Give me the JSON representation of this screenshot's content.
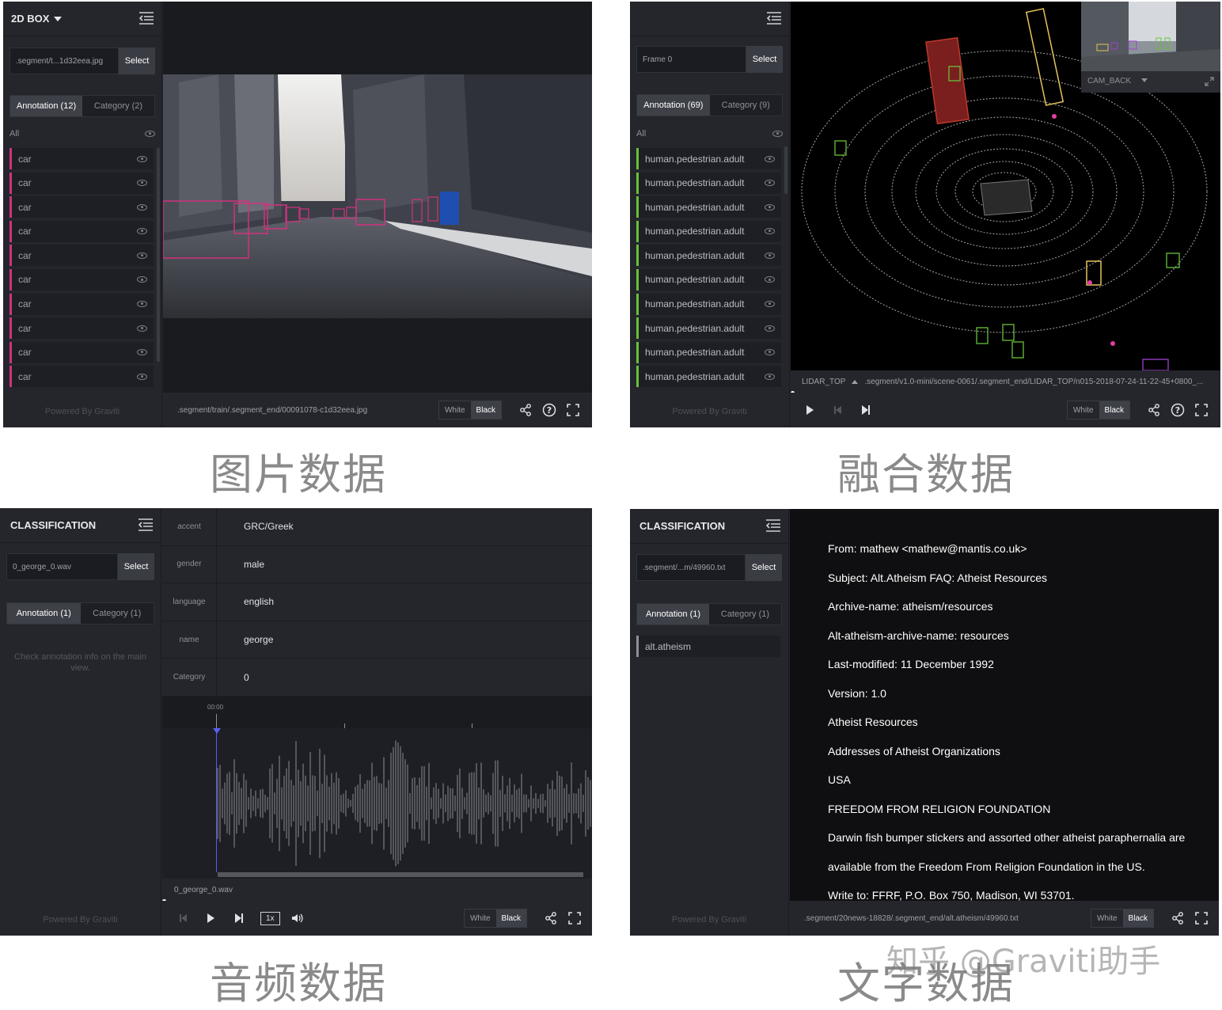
{
  "image_panel": {
    "title": "2D BOX",
    "file_input": ".segment/t...1d32eea.jpg",
    "select_label": "Select",
    "tabs": [
      {
        "label": "Annotation (12)"
      },
      {
        "label": "Category (2)"
      }
    ],
    "all_label": "All",
    "items": [
      {
        "label": "car"
      },
      {
        "label": "car"
      },
      {
        "label": "car"
      },
      {
        "label": "car"
      },
      {
        "label": "car"
      },
      {
        "label": "car"
      },
      {
        "label": "car"
      },
      {
        "label": "car"
      },
      {
        "label": "car"
      },
      {
        "label": "car"
      }
    ],
    "powered": "Powered By Graviti",
    "path": ".segment/train/.segment_end/00091078-c1d32eea.jpg",
    "white_label": "White",
    "black_label": "Black",
    "caption": "图片数据"
  },
  "fusion_panel": {
    "file_input": "Frame 0",
    "select_label": "Select",
    "tabs": [
      {
        "label": "Annotation (69)"
      },
      {
        "label": "Category (9)"
      }
    ],
    "all_label": "All",
    "items": [
      {
        "label": "human.pedestrian.adult"
      },
      {
        "label": "human.pedestrian.adult"
      },
      {
        "label": "human.pedestrian.adult"
      },
      {
        "label": "human.pedestrian.adult"
      },
      {
        "label": "human.pedestrian.adult"
      },
      {
        "label": "human.pedestrian.adult"
      },
      {
        "label": "human.pedestrian.adult"
      },
      {
        "label": "human.pedestrian.adult"
      },
      {
        "label": "human.pedestrian.adult"
      },
      {
        "label": "human.pedestrian.adult"
      }
    ],
    "powered": "Powered By Graviti",
    "cam_label": "CAM_BACK",
    "lidar_label": "LIDAR_TOP",
    "lidar_path": ".segment/v1.0-mini/scene-0061/.segment_end/LIDAR_TOP/n015-2018-07-24-11-22-45+0800_...",
    "white_label": "White",
    "black_label": "Black",
    "caption": "融合数据"
  },
  "audio_panel": {
    "title": "CLASSIFICATION",
    "file_input": "0_george_0.wav",
    "select_label": "Select",
    "tabs": [
      {
        "label": "Annotation (1)"
      },
      {
        "label": "Category (1)"
      }
    ],
    "hint": "Check annotation info on the main view.",
    "powered": "Powered By Graviti",
    "rows": [
      {
        "key": "accent",
        "value": "GRC/Greek"
      },
      {
        "key": "gender",
        "value": "male"
      },
      {
        "key": "language",
        "value": "english"
      },
      {
        "key": "name",
        "value": "george"
      },
      {
        "key": "Category",
        "value": "0"
      }
    ],
    "timestamp": "00:00",
    "filename": "0_george_0.wav",
    "speed": "1x",
    "white_label": "White",
    "black_label": "Black",
    "caption": "音频数据"
  },
  "text_panel": {
    "title": "CLASSIFICATION",
    "file_input": ".segment/...m/49960.txt",
    "select_label": "Select",
    "tabs": [
      {
        "label": "Annotation (1)"
      },
      {
        "label": "Category (1)"
      }
    ],
    "item": "alt.atheism",
    "powered": "Powered By Graviti",
    "lines": [
      "From: mathew <mathew@mantis.co.uk>",
      "Subject: Alt.Atheism FAQ: Atheist Resources",
      "Archive-name: atheism/resources",
      "Alt-atheism-archive-name: resources",
      "Last-modified: 11 December 1992",
      "Version: 1.0",
      "Atheist Resources",
      "Addresses of Atheist Organizations",
      "USA",
      "FREEDOM FROM RELIGION FOUNDATION",
      "Darwin fish bumper stickers and assorted other atheist paraphernalia are",
      "available from the Freedom From Religion Foundation in the US.",
      "Write to: FFRF, P.O. Box 750, Madison, WI 53701."
    ],
    "path": ".segment/20news-18828/.segment_end/alt.atheism/49960.txt",
    "white_label": "White",
    "black_label": "Black",
    "caption": "文字数据"
  },
  "watermark": "知乎 @Graviti助手",
  "colors": {
    "car_box": "#d0327f",
    "pedestrian": "#67c23a",
    "truck": "#e6c35a",
    "vehicle": "#c0392b"
  }
}
